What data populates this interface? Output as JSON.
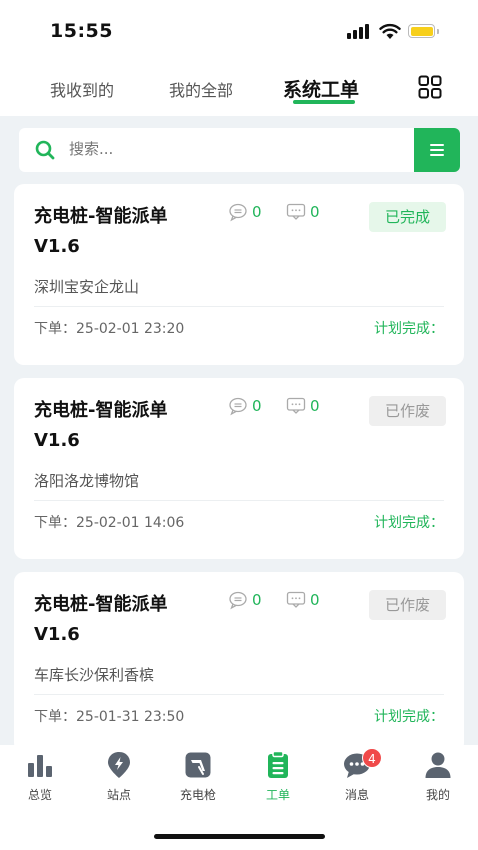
{
  "status_bar": {
    "time": "15:55"
  },
  "tabs": [
    {
      "label": "我收到的"
    },
    {
      "label": "我的全部"
    },
    {
      "label": "系统工单"
    }
  ],
  "search": {
    "placeholder": "搜索..."
  },
  "orders": [
    {
      "title": "充电桩-智能派单V1.6",
      "comments": "0",
      "messages": "0",
      "status": "已完成",
      "location": "深圳宝安企龙山",
      "order_time": "下单：25-02-01 23:20",
      "plan": "计划完成："
    },
    {
      "title": "充电桩-智能派单V1.6",
      "comments": "0",
      "messages": "0",
      "status": "已作废",
      "location": "洛阳洛龙博物馆",
      "order_time": "下单：25-02-01 14:06",
      "plan": "计划完成："
    },
    {
      "title": "充电桩-智能派单V1.6",
      "comments": "0",
      "messages": "0",
      "status": "已作废",
      "location": "车库长沙保利香槟",
      "order_time": "下单：25-01-31 23:50",
      "plan": "计划完成："
    }
  ],
  "nav": [
    {
      "label": "总览",
      "icon": "bar-chart-icon"
    },
    {
      "label": "站点",
      "icon": "location-icon"
    },
    {
      "label": "充电枪",
      "icon": "charger-icon"
    },
    {
      "label": "工单",
      "icon": "clipboard-icon"
    },
    {
      "label": "消息",
      "icon": "chat-icon",
      "badge": "4"
    },
    {
      "label": "我的",
      "icon": "user-icon"
    }
  ],
  "colors": {
    "accent": "#21b55a",
    "badge": "#f04a4a",
    "background": "#eef2f5"
  }
}
